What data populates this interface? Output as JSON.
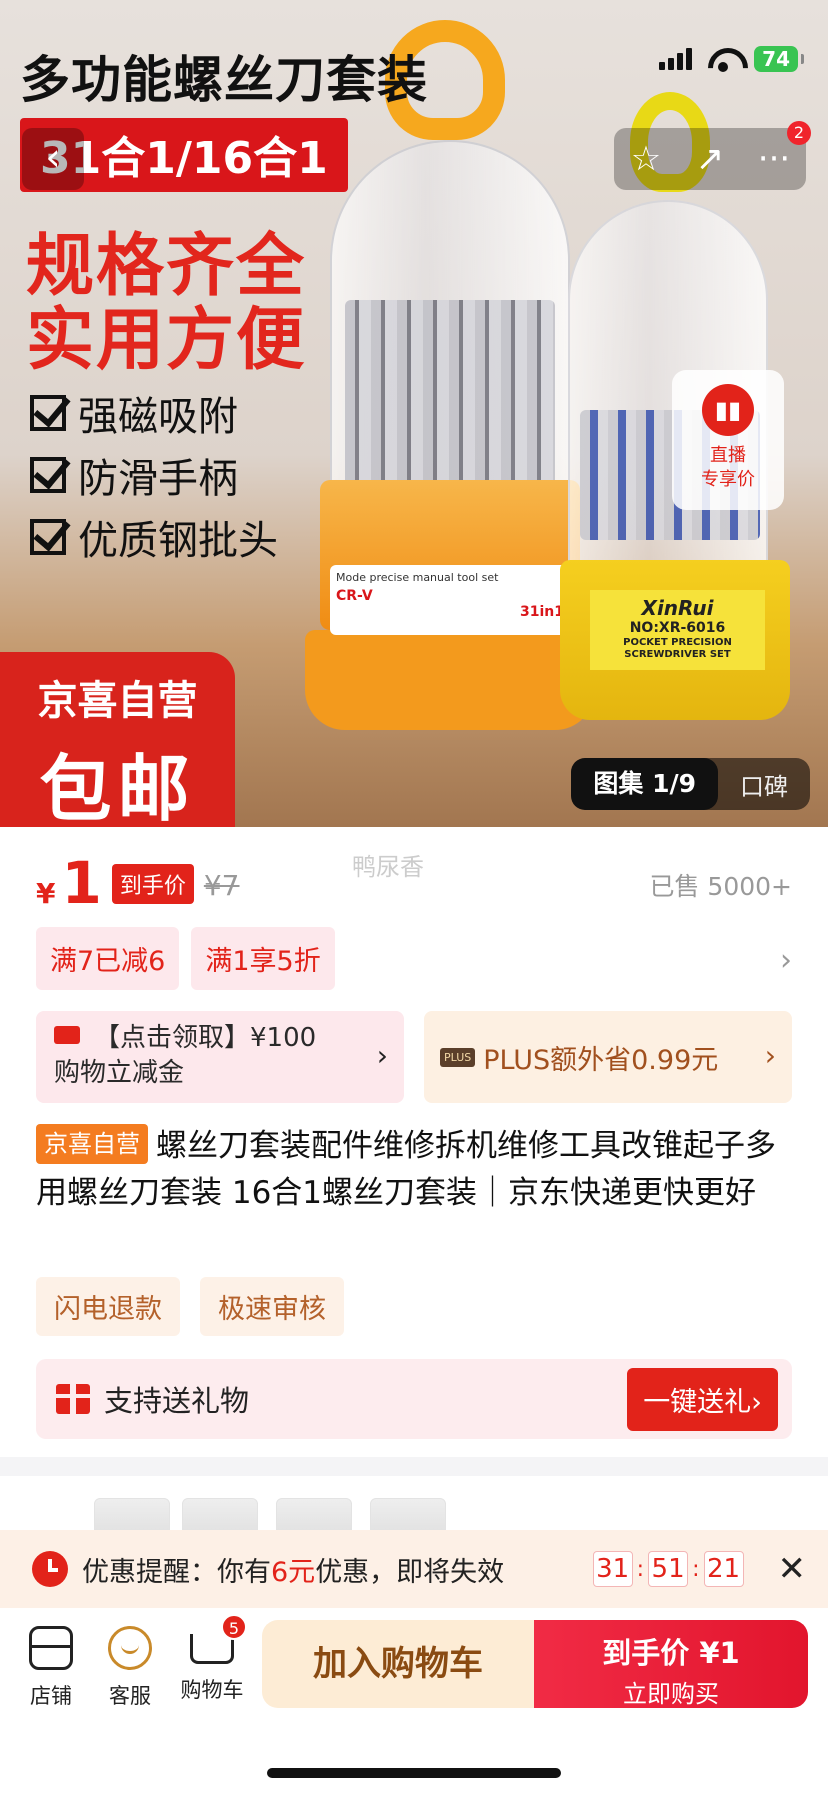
{
  "hero": {
    "title": "多功能螺丝刀套装",
    "tag": "31合1/16合1",
    "slogan1": "规格齐全",
    "slogan2": "实用方便",
    "features": [
      "强磁吸附",
      "防滑手柄",
      "优质钢批头"
    ],
    "badge_line1": "京喜自营",
    "badge_line2": "包邮",
    "label1_text": "Mode precise manual tool set",
    "label1_brand": "CR-V",
    "label1_count": "31in1",
    "label2_brand": "XinRui",
    "label2_model": "NO:XR-6016",
    "label2_desc": "POCKET PRECISION SCREWDRIVER SET",
    "live_text1": "直播",
    "live_text2": "专享价",
    "gallery_label": "图集 1/9",
    "reviews_label": "口碑"
  },
  "status": {
    "battery": "74"
  },
  "nav": {
    "back_icon": "‹",
    "star_icon": "☆",
    "share_icon": "↗",
    "more_icon": "···",
    "more_badge": "2"
  },
  "price": {
    "currency": "¥",
    "value": "1",
    "label": "到手价",
    "original": "¥7",
    "watermark": "鸭尿香",
    "sold": "已售 5000+"
  },
  "promos": [
    "满7已减6",
    "满1享5折"
  ],
  "coupons": {
    "c1_line1": "【点击领取】¥100",
    "c1_line2": "购物立减金",
    "c2_tag": "PLUS",
    "c2_text": "PLUS额外省0.99元"
  },
  "product": {
    "badge": "京喜自营",
    "title": "螺丝刀套装配件维修拆机维修工具改锥起子多用螺丝刀套装 16合1螺丝刀套装｜京东快递更快更好"
  },
  "services": [
    "闪电退款",
    "极速审核"
  ],
  "gift": {
    "label": "支持送礼物",
    "button": "一键送礼›"
  },
  "reminder": {
    "prefix": "优惠提醒：你有",
    "amount": "6元",
    "suffix": "优惠，即将失效",
    "h": "31",
    "m": "51",
    "s": "21"
  },
  "bottom": {
    "shop": "店铺",
    "service": "客服",
    "cart": "购物车",
    "cart_count": "5",
    "add_cart": "加入购物车",
    "buy_line1": "到手价 ¥1",
    "buy_line2": "立即购买"
  },
  "colors": {
    "accent": "#e2231a",
    "plus_text": "#a1501e",
    "battery": "#39c452"
  }
}
